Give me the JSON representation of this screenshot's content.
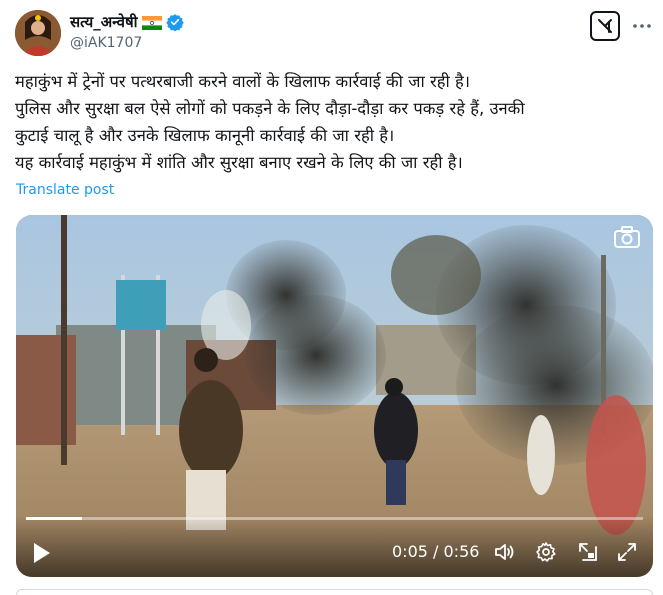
{
  "author": {
    "display_name": "सत्य_अन्वेषी",
    "handle": "@iAK1707",
    "flag": "india-flag-icon",
    "verified": true
  },
  "tweet": {
    "lines": [
      "महाकुंभ में ट्रेनों पर पत्थरबाजी करने वालों के खिलाफ कार्रवाई की जा रही है।",
      "पुलिस और सुरक्षा बल ऐसे लोगों को पकड़ने के लिए दौड़ा-दौड़ा कर पकड़ रहे हैं, उनकी",
      "कुटाई चालू है और उनके खिलाफ कानूनी कार्रवाई की जा रही है।",
      "यह कार्रवाई महाकुंभ में शांति और सुरक्षा बनाए रखने के लिए की जा रही है।"
    ],
    "translate_label": "Translate post"
  },
  "video": {
    "time_display": "0:05 / 0:56",
    "progress_fraction": 0.09
  },
  "colors": {
    "link_blue": "#1d9bf0",
    "verified_blue": "#1d9bf0",
    "text_primary": "#0f1419",
    "text_secondary": "#536471"
  }
}
